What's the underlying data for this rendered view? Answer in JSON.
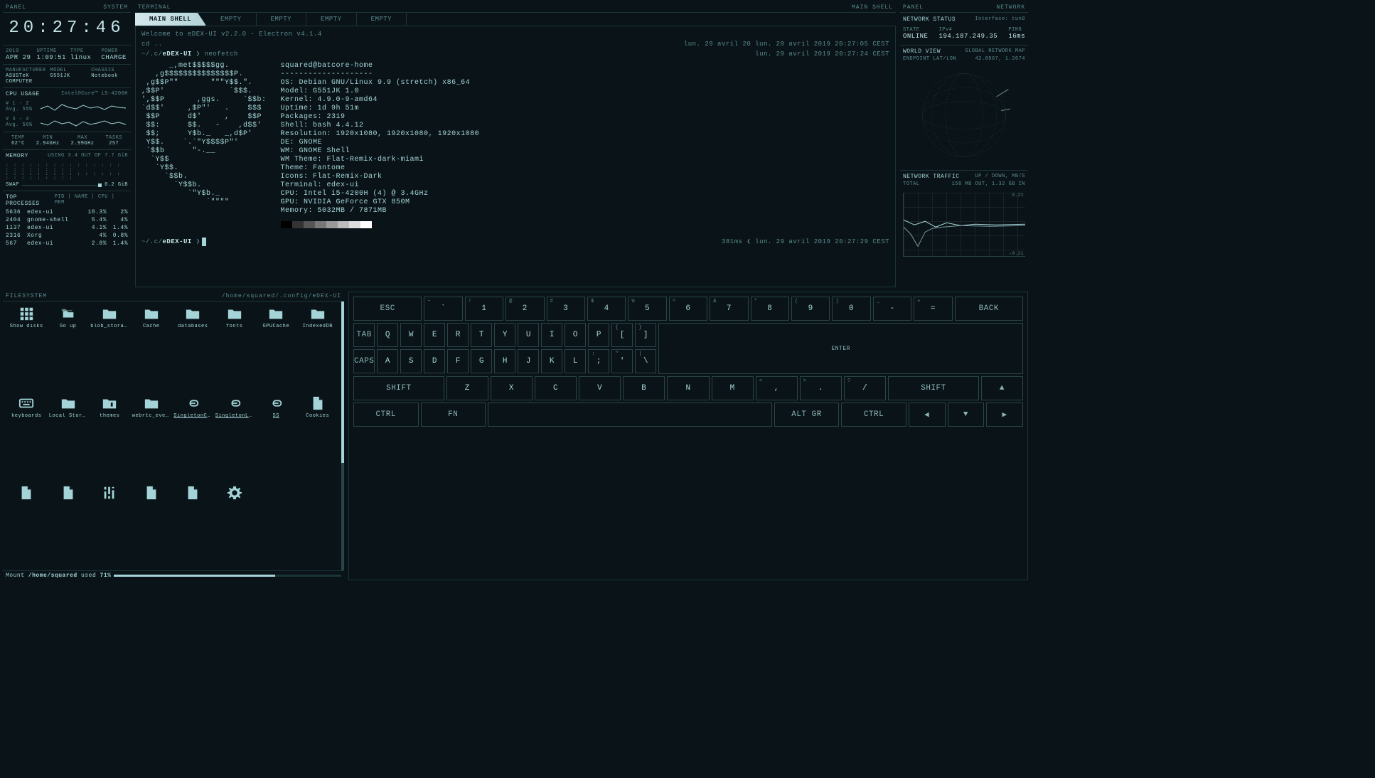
{
  "panels": {
    "left_header": {
      "l": "PANEL",
      "r": "SYSTEM"
    },
    "center_header": {
      "l": "TERMINAL",
      "r": "MAIN SHELL"
    },
    "right_header": {
      "l": "PANEL",
      "r": "NETWORK"
    }
  },
  "clock": "20:27:46",
  "sysinfo": {
    "year": "2019",
    "date": "APR 29",
    "uptime_l": "UPTIME",
    "uptime": "1:09:51",
    "type_l": "TYPE",
    "type": "linux",
    "power_l": "POWER",
    "power": "CHARGE",
    "mfg_l": "MANUFACTURER",
    "mfg": "ASUSTeK COMPUTER",
    "model_l": "MODEL",
    "model": "G551JK",
    "chassis_l": "CHASSIS",
    "chassis": "Notebook"
  },
  "cpu": {
    "title": "CPU USAGE",
    "sub": "Intel®Core™ i5-4200H",
    "rows": [
      {
        "l": "# 1 - 2",
        "avg": "Avg. 55%"
      },
      {
        "l": "# 3 - 4",
        "avg": "Avg. 56%"
      }
    ],
    "temp_l": "TEMP",
    "temp": "62°C",
    "min_l": "MIN",
    "min": "2.94GHz",
    "max_l": "MAX",
    "max": "2.99GHz",
    "tasks_l": "TASKS",
    "tasks": "257"
  },
  "memory": {
    "title": "MEMORY",
    "sub": "USING 3.4 OUT OF 7.7 GiB",
    "swap_l": "SWAP",
    "swap": "0.2 GiB"
  },
  "processes": {
    "title": "TOP PROCESSES",
    "hdr": "PID | NAME | CPU | MEM",
    "rows": [
      {
        "pid": "5636",
        "name": "edex-ui",
        "cpu": "10.3%",
        "mem": "2%"
      },
      {
        "pid": "2404",
        "name": "gnome-shell",
        "cpu": "5.4%",
        "mem": "4%"
      },
      {
        "pid": "1137",
        "name": "edex-ui",
        "cpu": "4.1%",
        "mem": "1.4%"
      },
      {
        "pid": "2316",
        "name": "Xorg",
        "cpu": "4%",
        "mem": "0.8%"
      },
      {
        "pid": "567",
        "name": "edex-ui",
        "cpu": "2.8%",
        "mem": "1.4%"
      }
    ]
  },
  "terminal": {
    "tabs": [
      "MAIN SHELL",
      "EMPTY",
      "EMPTY",
      "EMPTY",
      "EMPTY"
    ],
    "welcome": "Welcome to eDEX-UI v2.2.0 - Electron v4.1.4",
    "cd": "cd ..",
    "ts1": "lun. 29 avril 20 lun. 29 avril 2019 20:27:05 CEST",
    "ts2": "lun. 29 avril 2019 20:27:24 CEST",
    "prompt_pre": "~/.c/",
    "prompt_bold": "eDEX-UI",
    "prompt_arrow": "❯",
    "cmd": "neofetch",
    "ascii": "      _,met$$$$$gg.\n   ,g$$$$$$$$$$$$$$$P.\n ,g$$P\"\"       \"\"\"Y$$.\".\n,$$P'              `$$$.\n',$$P       ,ggs.     `$$b:\n`d$$'     ,$P\"'   .    $$$\n $$P      d$'     ,    $$P\n $$:      $$.   -    ,d$$'\n $$;      Y$b._   _,d$P'\n Y$$.    `.`\"Y$$$$P\"'\n `$$b      \"-.__\n  `Y$$\n   `Y$$.\n     `$$b.\n       `Y$$b.\n          `\"Y$b._\n              `\"\"\"\"",
    "neofetch": {
      "host": "squared@batcore-home",
      "sep": "--------------------",
      "lines": [
        "OS: Debian GNU/Linux 9.9 (stretch) x86_64",
        "Model: G551JK 1.0",
        "Kernel: 4.9.0-9-amd64",
        "Uptime: 1d 9h 51m",
        "Packages: 2319",
        "Shell: bash 4.4.12",
        "Resolution: 1920x1080, 1920x1080, 1920x1080",
        "DE: GNOME",
        "WM: GNOME Shell",
        "WM Theme: Flat-Remix-dark-miami",
        "Theme: Fantome",
        "Icons: Flat-Remix-Dark",
        "Terminal: edex-ui",
        "CPU: Intel i5-4200H (4) @ 3.4GHz",
        "GPU: NVIDIA GeForce GTX 850M",
        "Memory: 5032MB / 7871MB"
      ]
    },
    "bottom_latency": "381ms",
    "bottom_arrow": "❮",
    "bottom_ts": "lun. 29 avril 2019 20:27:29 CEST"
  },
  "network": {
    "status_title": "NETWORK STATUS",
    "iface_l": "Interface:",
    "iface": "tun0",
    "state_l": "STATE",
    "state": "ONLINE",
    "ip_l": "IPv4",
    "ip": "194.187.249.35",
    "ping_l": "PING",
    "ping": "16ms",
    "world_title": "WORLD VIEW",
    "world_sub": "GLOBAL NETWORK MAP",
    "endpoint_l": "ENDPOINT LAT/LON",
    "endpoint": "42.8907, 1.2674",
    "traffic_title": "NETWORK TRAFFIC",
    "traffic_sub": "UP / DOWN, MB/S",
    "total_l": "TOTAL",
    "total": "158 MB OUT, 1.32 GB IN",
    "y_top": "0.21",
    "y_bot": "-0.21"
  },
  "filesystem": {
    "header_l": "FILESYSTEM",
    "header_r": "/home/squared/.config/eDEX-UI",
    "items": [
      {
        "label": "Show disks",
        "icon": "grid"
      },
      {
        "label": "Go up",
        "icon": "folders"
      },
      {
        "label": "blob_storage",
        "icon": "folder"
      },
      {
        "label": "Cache",
        "icon": "folder"
      },
      {
        "label": "databases",
        "icon": "folder"
      },
      {
        "label": "fonts",
        "icon": "folder"
      },
      {
        "label": "GPUCache",
        "icon": "folder"
      },
      {
        "label": "IndexedDB",
        "icon": "folder"
      },
      {
        "label": "keyboards",
        "icon": "keyboard"
      },
      {
        "label": "Local Storage",
        "icon": "folder"
      },
      {
        "label": "themes",
        "icon": "brush"
      },
      {
        "label": "webrtc_even…",
        "icon": "folder"
      },
      {
        "label": "SingletonCo…",
        "icon": "link",
        "u": 1
      },
      {
        "label": "SingletonLock",
        "icon": "link",
        "u": 1
      },
      {
        "label": "SS",
        "icon": "link",
        "u": 1
      },
      {
        "label": "Cookies",
        "icon": "file"
      },
      {
        "label": "",
        "icon": "file"
      },
      {
        "label": "",
        "icon": "file"
      },
      {
        "label": "",
        "icon": "sliders"
      },
      {
        "label": "",
        "icon": "file"
      },
      {
        "label": "",
        "icon": "file"
      },
      {
        "label": "",
        "icon": "gear"
      }
    ],
    "footer_pre": "Mount ",
    "footer_path": "/home/squared",
    "footer_mid": " used ",
    "footer_pct": "71%"
  },
  "keyboard": {
    "row1": [
      {
        "m": "ESC",
        "w": "wide",
        "s": 1
      },
      {
        "t": "~",
        "m": "`"
      },
      {
        "t": "!",
        "m": "1"
      },
      {
        "t": "@",
        "m": "2"
      },
      {
        "t": "#",
        "m": "3"
      },
      {
        "t": "$",
        "m": "4"
      },
      {
        "t": "%",
        "m": "5"
      },
      {
        "t": "^",
        "m": "6"
      },
      {
        "t": "&",
        "m": "7"
      },
      {
        "t": "*",
        "m": "8"
      },
      {
        "t": "(",
        "m": "9"
      },
      {
        "t": ")",
        "m": "0"
      },
      {
        "t": "_",
        "m": "-"
      },
      {
        "t": "+",
        "m": "="
      },
      {
        "m": "BACK",
        "w": "wide",
        "s": 1
      }
    ],
    "row2": [
      {
        "m": "TAB",
        "w": "wide",
        "s": 1
      },
      {
        "m": "Q"
      },
      {
        "m": "W"
      },
      {
        "m": "E"
      },
      {
        "m": "R"
      },
      {
        "m": "T"
      },
      {
        "m": "Y"
      },
      {
        "m": "U"
      },
      {
        "m": "I"
      },
      {
        "m": "O"
      },
      {
        "m": "P"
      },
      {
        "t": "{",
        "m": "["
      },
      {
        "t": "}",
        "m": "]"
      }
    ],
    "enter": "ENTER",
    "row3": [
      {
        "m": "CAPS",
        "w": "wide",
        "s": 1
      },
      {
        "m": "A"
      },
      {
        "m": "S"
      },
      {
        "m": "D"
      },
      {
        "m": "F"
      },
      {
        "m": "G"
      },
      {
        "m": "H"
      },
      {
        "m": "J"
      },
      {
        "m": "K"
      },
      {
        "m": "L"
      },
      {
        "t": ":",
        "m": ";"
      },
      {
        "t": "\"",
        "m": "'"
      },
      {
        "t": "|",
        "m": "\\"
      }
    ],
    "row4": [
      {
        "m": "SHIFT",
        "w": "wider",
        "s": 1
      },
      {
        "m": "Z"
      },
      {
        "m": "X"
      },
      {
        "m": "C"
      },
      {
        "m": "V"
      },
      {
        "m": "B"
      },
      {
        "m": "N"
      },
      {
        "m": "M"
      },
      {
        "t": "<",
        "m": ","
      },
      {
        "t": ">",
        "m": "."
      },
      {
        "t": "?",
        "m": "/"
      },
      {
        "m": "SHIFT",
        "w": "wider",
        "s": 1
      },
      {
        "m": "▲",
        "s": 1
      }
    ],
    "row5": [
      {
        "m": "CTRL",
        "w": "wide",
        "s": 1
      },
      {
        "m": "FN",
        "w": "wide",
        "s": 1
      },
      {
        "m": "",
        "w": "space"
      },
      {
        "m": "ALT GR",
        "w": "wide",
        "s": 1
      },
      {
        "m": "CTRL",
        "w": "wide",
        "s": 1
      },
      {
        "m": "◀",
        "s": 1
      },
      {
        "m": "▼",
        "s": 1
      },
      {
        "m": "▶",
        "s": 1
      }
    ]
  }
}
